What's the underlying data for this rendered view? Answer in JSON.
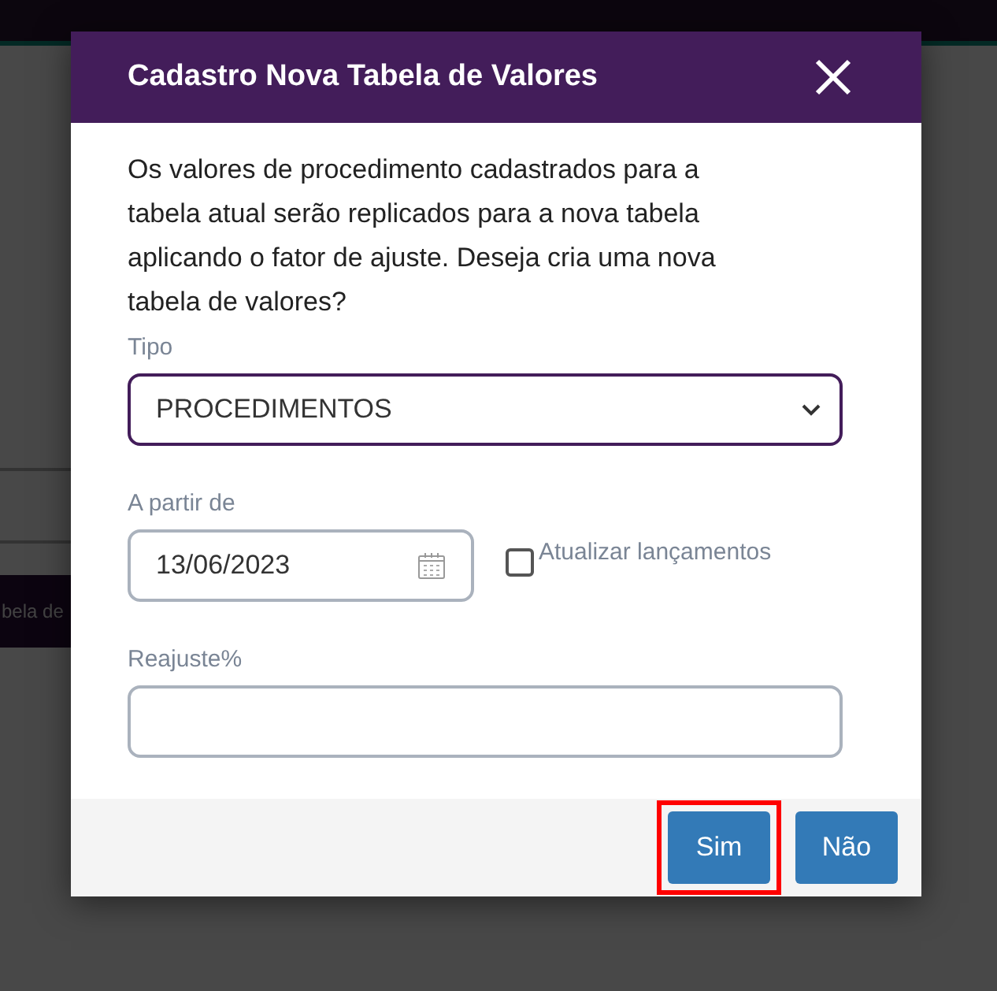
{
  "background": {
    "button_text": "bela de"
  },
  "dialog": {
    "title": "Cadastro Nova Tabela de Valores",
    "message": "Os valores de procedimento cadastrados para a tabela atual serão replicados para a nova tabela aplicando o fator de ajuste. Deseja cria uma nova tabela de valores?",
    "fields": [
      {
        "kind": "select",
        "label": "Tipo",
        "value": "PROCEDIMENTOS",
        "focused": true
      },
      {
        "kind": "date",
        "label": "A partir de",
        "value": "13/06/2023",
        "focused": false
      },
      {
        "kind": "text",
        "label": "Reajuste%",
        "focused": false
      }
    ],
    "checkbox": {
      "label": "Atualizar lançamentos",
      "checked": false
    },
    "buttons": [
      {
        "label": "Sim",
        "highlighted": true
      },
      {
        "label": "Não",
        "highlighted": false
      }
    ]
  }
}
